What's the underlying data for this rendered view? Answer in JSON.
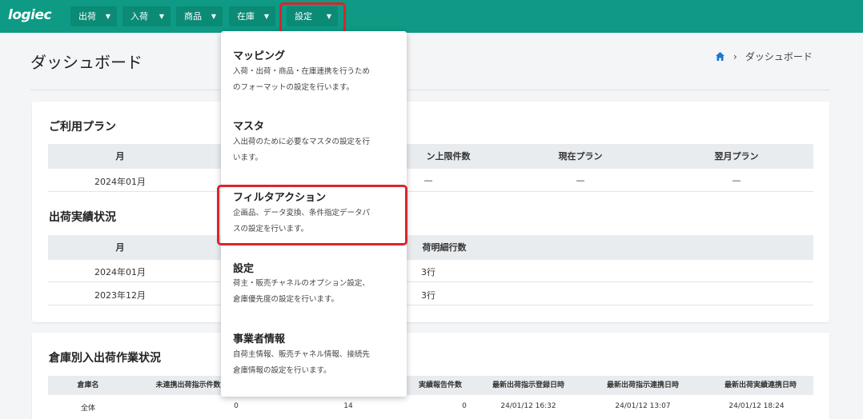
{
  "nav": {
    "logo": "logiec",
    "items": [
      {
        "label": "出荷"
      },
      {
        "label": "入荷"
      },
      {
        "label": "商品"
      },
      {
        "label": "在庫"
      },
      {
        "label": "設定"
      }
    ]
  },
  "page": {
    "title": "ダッシュボード",
    "breadcrumb": "ダッシュボード"
  },
  "plan": {
    "title": "ご利用プラン",
    "headers": [
      "月",
      "ン上限件数",
      "現在プラン",
      "翌月プラン"
    ],
    "row": [
      "2024年01月",
      "—",
      "—",
      "—"
    ]
  },
  "shipping": {
    "title": "出荷実績状況",
    "headers": [
      "月",
      "荷明細行数"
    ],
    "rows": [
      [
        "2024年01月",
        "3行"
      ],
      [
        "2023年12月",
        "3行"
      ]
    ]
  },
  "warehouse": {
    "title": "倉庫別入出荷作業状況",
    "headers": [
      "倉庫名",
      "未連携出荷指示件数",
      "実績報告件数",
      "最新出荷指示登録日時",
      "最新出荷指示連携日時",
      "最新出荷実績連携日時"
    ],
    "row": [
      "全体",
      "0",
      "14",
      "0",
      "24/01/12 16:32",
      "24/01/12 13:07",
      "24/01/12 18:24"
    ]
  },
  "settings_menu": [
    {
      "title": "マッピング",
      "desc1": "入荷・出荷・商品・在庫連携を行うため",
      "desc2": "のフォーマットの設定を行います。"
    },
    {
      "title": "マスタ",
      "desc1": "入出荷のために必要なマスタの設定を行",
      "desc2": "います。"
    },
    {
      "title": "フィルタアクション",
      "desc1": "企画品、データ変換、条件指定データパ",
      "desc2": "スの設定を行います。"
    },
    {
      "title": "設定",
      "desc1": "荷主・販売チャネルのオプション設定、",
      "desc2": "倉庫優先度の設定を行います。"
    },
    {
      "title": "事業者情報",
      "desc1": "自荷主情報、販売チャネル情報、接続先",
      "desc2": "倉庫情報の設定を行います。"
    }
  ]
}
